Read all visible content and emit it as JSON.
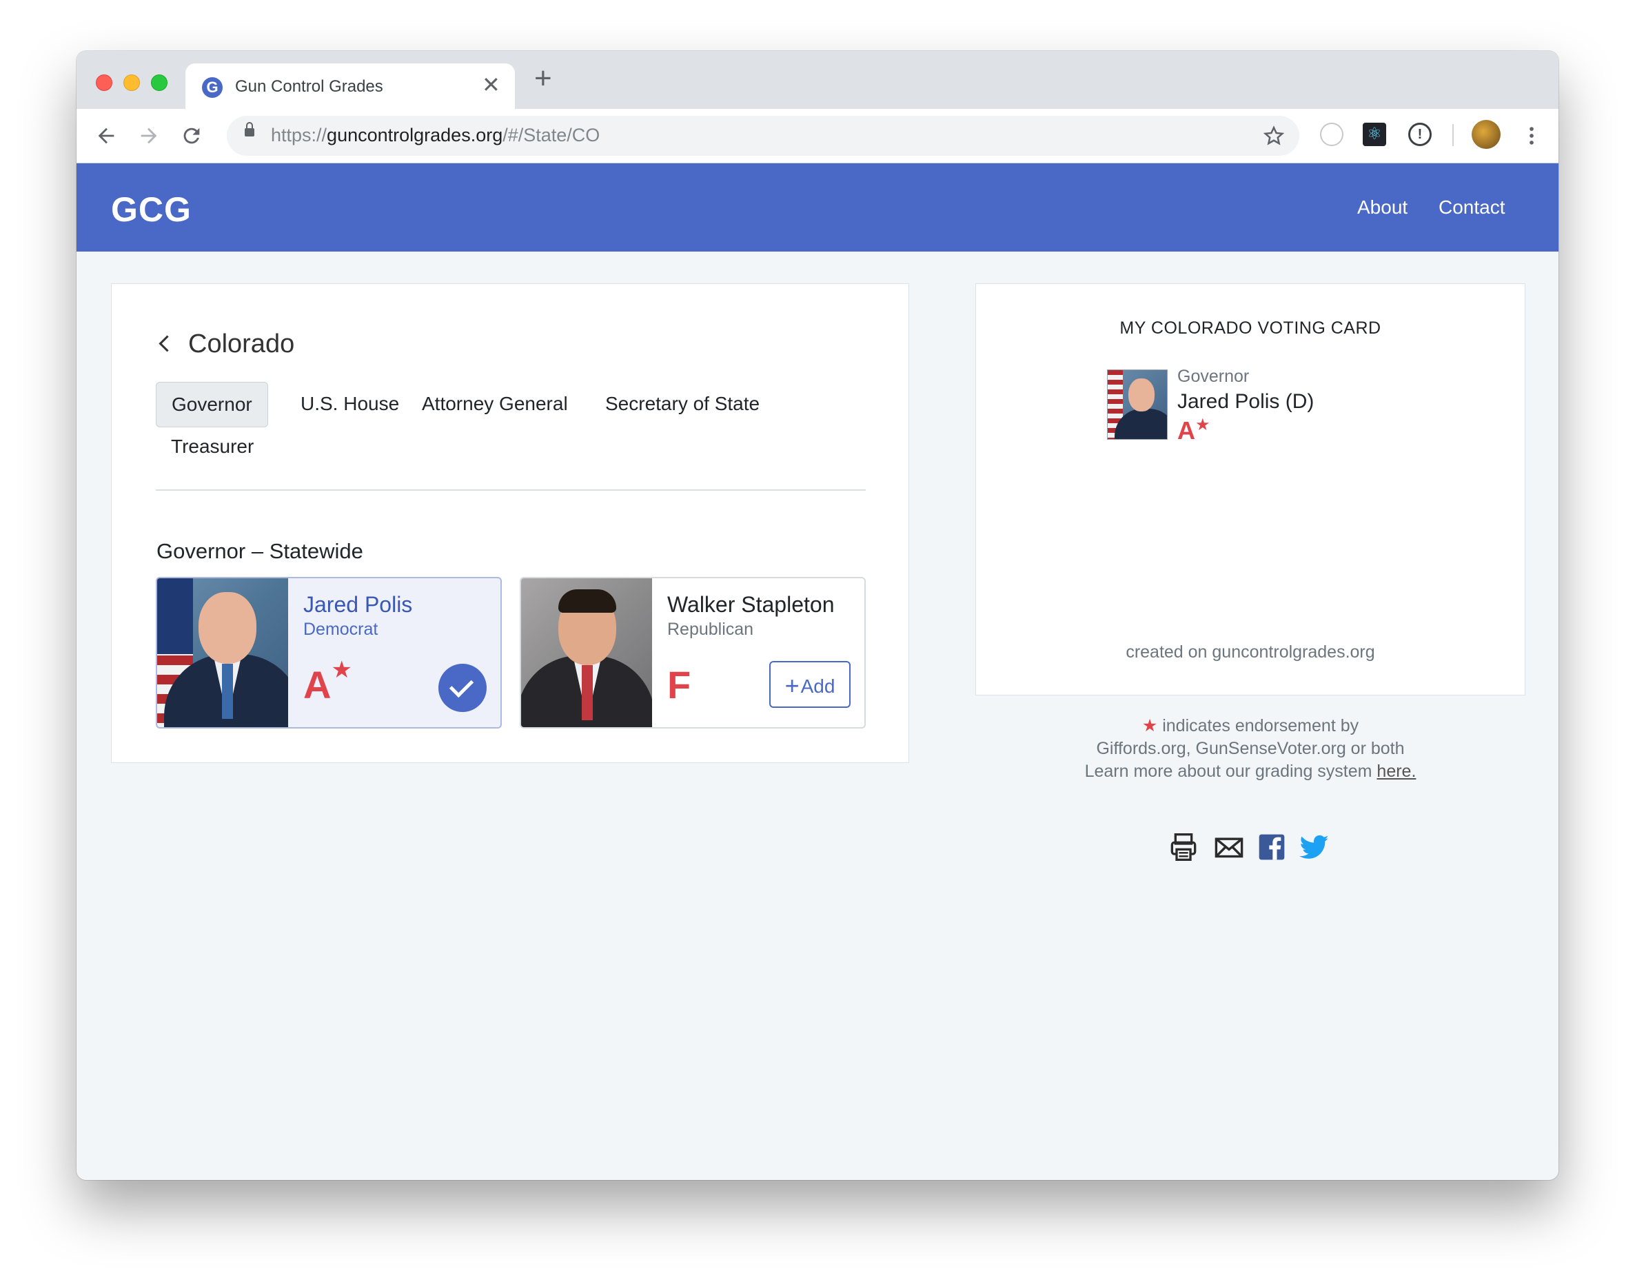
{
  "browser": {
    "tab_title": "Gun Control Grades",
    "tab_favicon_letter": "G",
    "close_glyph": "✕",
    "new_tab_glyph": "+",
    "url_scheme": "https://",
    "url_host": "guncontrolgrades.org",
    "url_path": "/#/State/CO",
    "ext_react_glyph": "⚛",
    "ext_info_glyph": "!"
  },
  "header": {
    "brand": "GCG",
    "nav": [
      "About",
      "Contact"
    ]
  },
  "state": {
    "back_label": "Colorado",
    "tabs": [
      "Governor",
      "U.S. House",
      "Attorney General",
      "Secretary of State",
      "Treasurer"
    ],
    "active_tab": "Governor"
  },
  "race": {
    "title": "Governor – Statewide",
    "candidates": [
      {
        "name": "Jared Polis",
        "party": "Democrat",
        "grade": "A",
        "endorsed_star": "★",
        "selected": true
      },
      {
        "name": "Walker Stapleton",
        "party": "Republican",
        "grade": "F",
        "add_plus": "+",
        "add_label": "Add",
        "selected": false
      }
    ]
  },
  "voting_card": {
    "title": "MY COLORADO VOTING CARD",
    "entry_office": "Governor",
    "entry_name": "Jared Polis (D)",
    "entry_grade": "A",
    "entry_star": "★",
    "footer": "created on guncontrolgrades.org"
  },
  "legend": {
    "star": "★",
    "line1": " indicates endorsement by",
    "line2": "Giffords.org, GunSenseVoter.org or both",
    "line3": "Learn more about our grading system ",
    "link": "here."
  },
  "share_icons": [
    "print-icon",
    "email-icon",
    "facebook-icon",
    "twitter-icon"
  ],
  "colors": {
    "brand_blue": "#4a69c6",
    "grade_red": "#e0434a",
    "facebook": "#3b5998",
    "twitter": "#1da1f2"
  }
}
